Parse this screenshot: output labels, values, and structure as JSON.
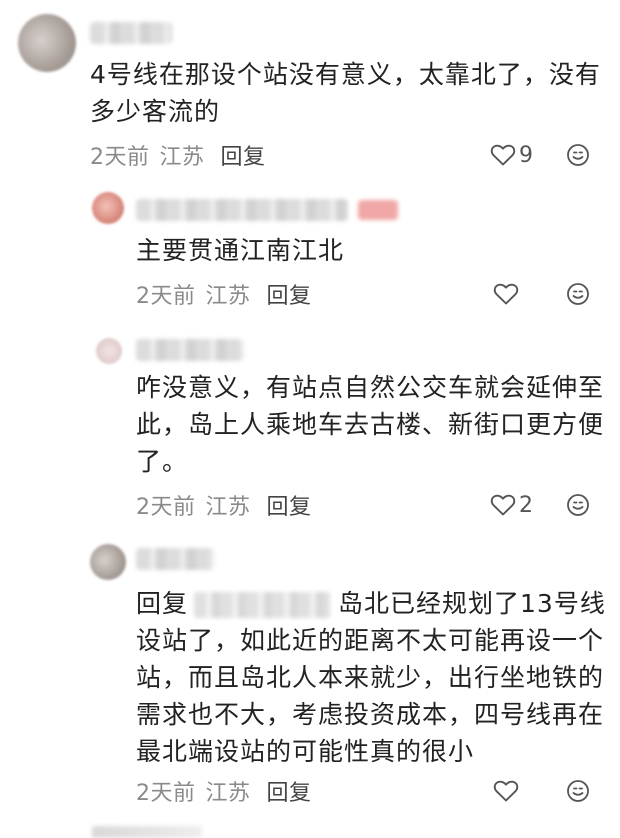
{
  "comments": [
    {
      "text": "4号线在那设个站没有意义，太靠北了，没有多少客流的",
      "time": "2天前",
      "location": "江苏",
      "reply_label": "回复",
      "likes": "9"
    },
    {
      "text": "主要贯通江南江北",
      "time": "2天前",
      "location": "江苏",
      "reply_label": "回复",
      "likes": ""
    },
    {
      "text": "咋没意义，有站点自然公交车就会延伸至此，岛上人乘地车去古楼、新街口更方便了。",
      "time": "2天前",
      "location": "江苏",
      "reply_label": "回复",
      "likes": "2"
    },
    {
      "reply_prefix": "回复",
      "text": "岛北已经规划了13号线设站了，如此近的距离不太可能再设一个站，而且岛北人本来就少，出行坐地铁的需求也不大，考虑投资成本，四号线再在最北端设站的可能性真的很小",
      "time": "2天前",
      "location": "江苏",
      "reply_label": "回复",
      "likes": ""
    }
  ],
  "icons": {
    "like": "heart-outline-icon",
    "emoji": "smiley-icon"
  },
  "colors": {
    "text": "#222222",
    "meta": "#8a8a8a",
    "icon": "#555555"
  }
}
